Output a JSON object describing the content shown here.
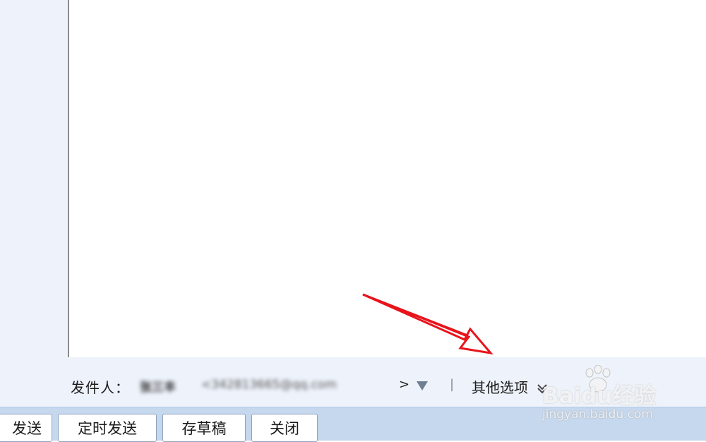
{
  "composer": {
    "sender_label": "发件人：",
    "sender_name": "张三丰",
    "sender_email": "<342813665@qq.com",
    "sender_email_close": ">",
    "sender_dropdown_icon": "triangle-down-icon",
    "divider": "|",
    "other_options_label": "其他选项",
    "other_options_icon": "chevron-down-icon"
  },
  "toolbar": {
    "send_label": "发送",
    "schedule_label": "定时发送",
    "draft_label": "存草稿",
    "close_label": "关闭"
  },
  "watermark": {
    "brand": "Baidu经验",
    "url": "jingyan.baidu.com"
  },
  "annotation": {
    "arrow_color": "#e8141c",
    "icon": "red-arrow-icon"
  },
  "colors": {
    "sidebar_bg": "#eef3fb",
    "toolbar_bg": "#c6d8ee"
  }
}
